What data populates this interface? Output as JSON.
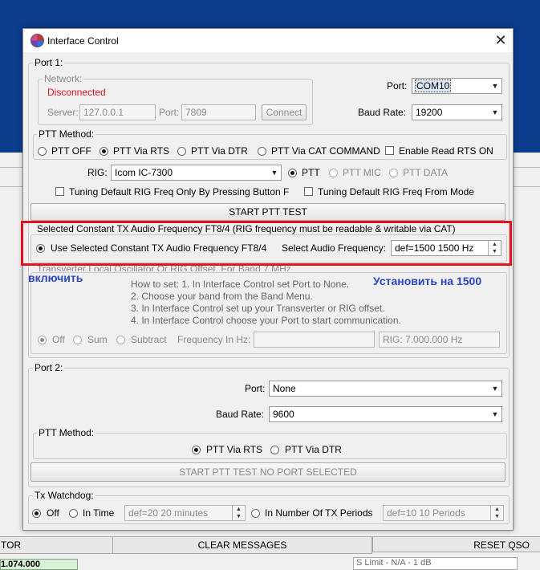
{
  "window": {
    "title": "Interface Control",
    "close_glyph": "✕"
  },
  "port1": {
    "label": "Port 1:",
    "network": {
      "label": "Network:",
      "status": "Disconnected",
      "server_label": "Server:",
      "server_value": "127.0.0.1",
      "port_label": "Port:",
      "port_value": "7809",
      "connect_label": "Connect"
    },
    "port_label": "Port:",
    "port_value": "COM10",
    "baud_label": "Baud Rate:",
    "baud_value": "19200",
    "ptt": {
      "label": "PTT Method:",
      "options": [
        "PTT OFF",
        "PTT Via RTS",
        "PTT Via DTR",
        "PTT Via CAT COMMAND"
      ],
      "selected": "PTT Via RTS",
      "enable_rts_label": "Enable Read RTS ON"
    },
    "rig_label": "RIG:",
    "rig_value": "Icom IC-7300",
    "rig_ptt_options": [
      "PTT",
      "PTT MIC",
      "PTT DATA"
    ],
    "rig_ptt_selected": "PTT",
    "tuning_button_label": "Tuning Default RIG Freq Only By Pressing Button F",
    "tuning_mode_label": "Tuning Default RIG Freq From Mode",
    "start_ptt_label": "START PTT TEST",
    "constant_tx": {
      "label": "Selected Constant TX  Audio Frequency FT8/4 (RIG frequency must be readable & writable via CAT)",
      "use_label": "Use Selected Constant TX  Audio Frequency FT8/4",
      "select_label": "Select  Audio Frequency:",
      "value": "def=1500  1500  Hz"
    },
    "transverter": {
      "label": "Transverter Local Oscillator Or RIG Offset.  For Band 7 MHz",
      "howto": [
        "How to set: 1. In Interface Control set Port to None.",
        "2. Choose your band from the Band Menu.",
        "3. In Interface Control set up your Transverter or RIG offset.",
        "4. In Interface Control choose your Port to start communication."
      ],
      "options": [
        "Off",
        "Sum",
        "Subtract"
      ],
      "selected": "Off",
      "freq_label": "Frequency In Hz:",
      "freq_value": "",
      "rig_value": "RIG: 7.000.000 Hz"
    }
  },
  "port2": {
    "label": "Port 2:",
    "port_label": "Port:",
    "port_value": "None",
    "baud_label": "Baud Rate:",
    "baud_value": "9600",
    "ptt": {
      "label": "PTT Method:",
      "options": [
        "PTT Via RTS",
        "PTT Via DTR"
      ],
      "selected": "PTT Via RTS"
    },
    "start_ptt_label": "START PTT TEST     NO PORT SELECTED"
  },
  "watchdog": {
    "label": "Tx Watchdog:",
    "off_label": "Off",
    "time_label": "In Time",
    "time_value": "def=20  20  minutes",
    "periods_label": "In Number Of TX Periods",
    "periods_value": "def=10  10  Periods",
    "selected": "Off"
  },
  "annotations": {
    "left": "включить",
    "right": "Установить на 1500"
  },
  "background": {
    "left_tab": "TOR",
    "clear_messages": "CLEAR MESSAGES",
    "reset_qso": "RESET QSO",
    "status_left": "1.074.000",
    "status_right": "S Limit - N/A - 1  dB"
  },
  "colors": {
    "disconnected": "#e3121b",
    "annotation_box": "#e3121b",
    "annotation_text": "#2b44c4",
    "title_bg": "#0b3c8c"
  }
}
